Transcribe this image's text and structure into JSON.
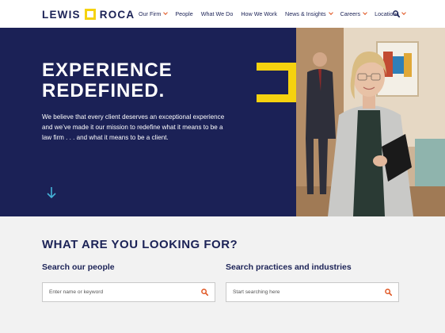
{
  "brand": {
    "logo_left": "LEWIS",
    "logo_right": "ROCA",
    "accent": "#f5d20f",
    "navy": "#1b2156",
    "orange": "#e0541f"
  },
  "nav": {
    "items": [
      {
        "label": "Our Firm",
        "dropdown": true
      },
      {
        "label": "People",
        "dropdown": false
      },
      {
        "label": "What We Do",
        "dropdown": false
      },
      {
        "label": "How We Work",
        "dropdown": false
      },
      {
        "label": "News & Insights",
        "dropdown": true
      },
      {
        "label": "Careers",
        "dropdown": true
      },
      {
        "label": "Locations",
        "dropdown": true
      }
    ],
    "search_icon": "search-icon"
  },
  "hero": {
    "title_line1": "EXPERIENCE",
    "title_line2": "REDEFINED.",
    "body": "We believe that every client deserves an exceptional experience and we’ve made it our mission to redefine what it means to be a law firm . . . and what it means to be a client.",
    "scroll_icon": "arrow-down-icon"
  },
  "search_section": {
    "title": "WHAT ARE YOU LOOKING FOR?",
    "people": {
      "label": "Search our people",
      "placeholder": "Enter name or keyword"
    },
    "practices": {
      "label": "Search practices and industries",
      "placeholder": "Start searching here"
    }
  }
}
